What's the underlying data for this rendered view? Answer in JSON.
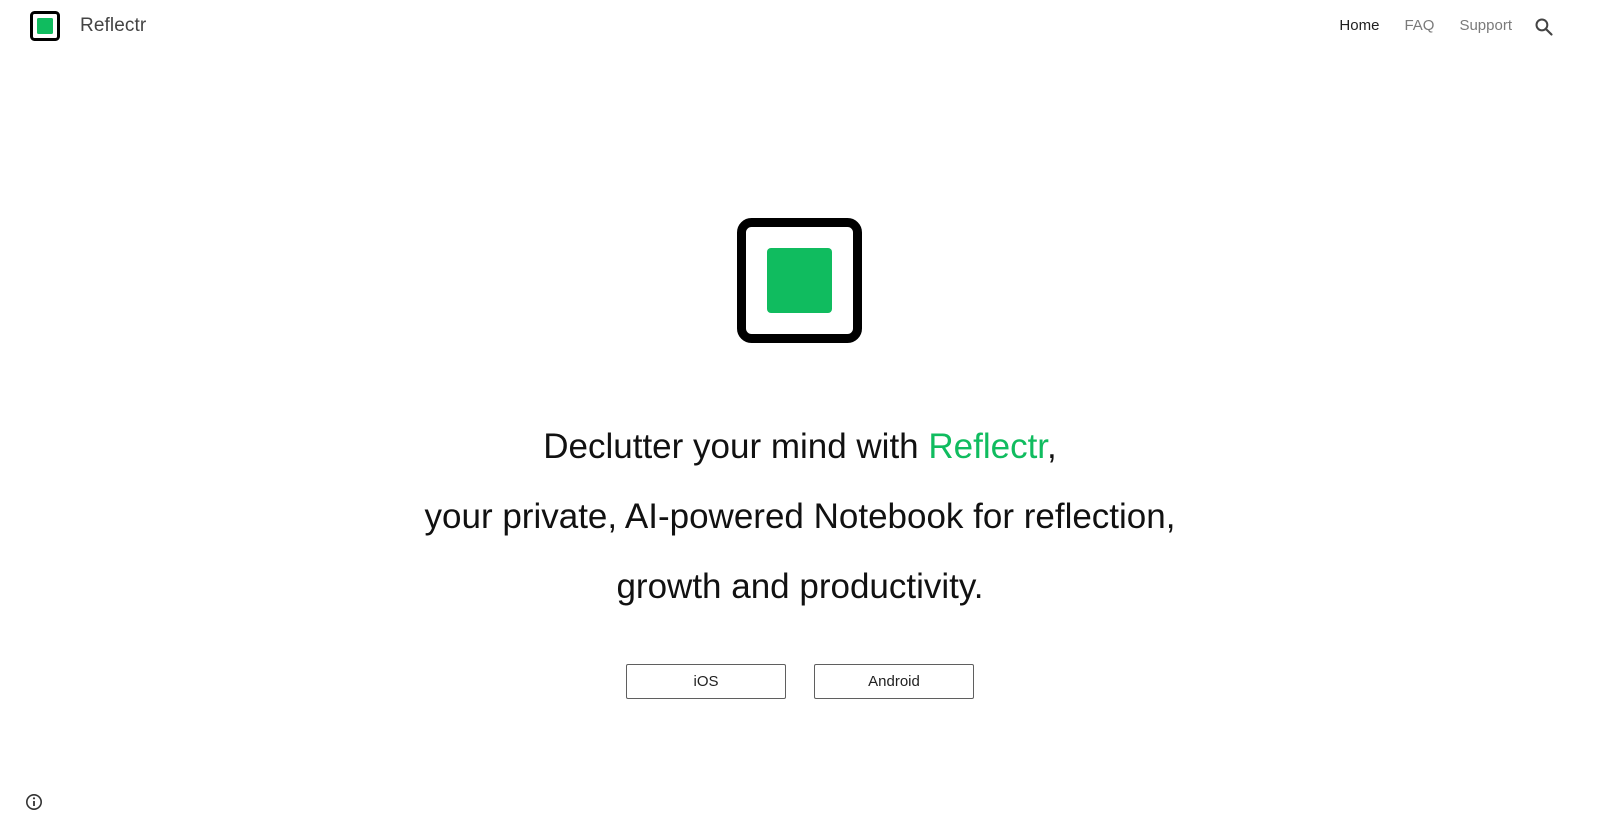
{
  "header": {
    "brand_name": "Reflectr",
    "nav": [
      {
        "label": "Home",
        "active": true
      },
      {
        "label": "FAQ",
        "active": false
      },
      {
        "label": "Support",
        "active": false
      }
    ],
    "search_icon": "search-icon"
  },
  "hero": {
    "logo_icon": "reflectr-logo",
    "line1_prefix": "Declutter your mind with ",
    "line1_accent": "Reflectr",
    "line1_suffix": ",",
    "line2": "your private, AI-powered Notebook for reflection,",
    "line3": "growth and productivity."
  },
  "buttons": {
    "ios_label": "iOS",
    "android_label": "Android"
  },
  "footer": {
    "info_icon": "info-icon"
  },
  "colors": {
    "accent": "#10bc5f",
    "logo_frame": "#000000",
    "text": "#111111",
    "nav_inactive": "#7a7a7a"
  }
}
